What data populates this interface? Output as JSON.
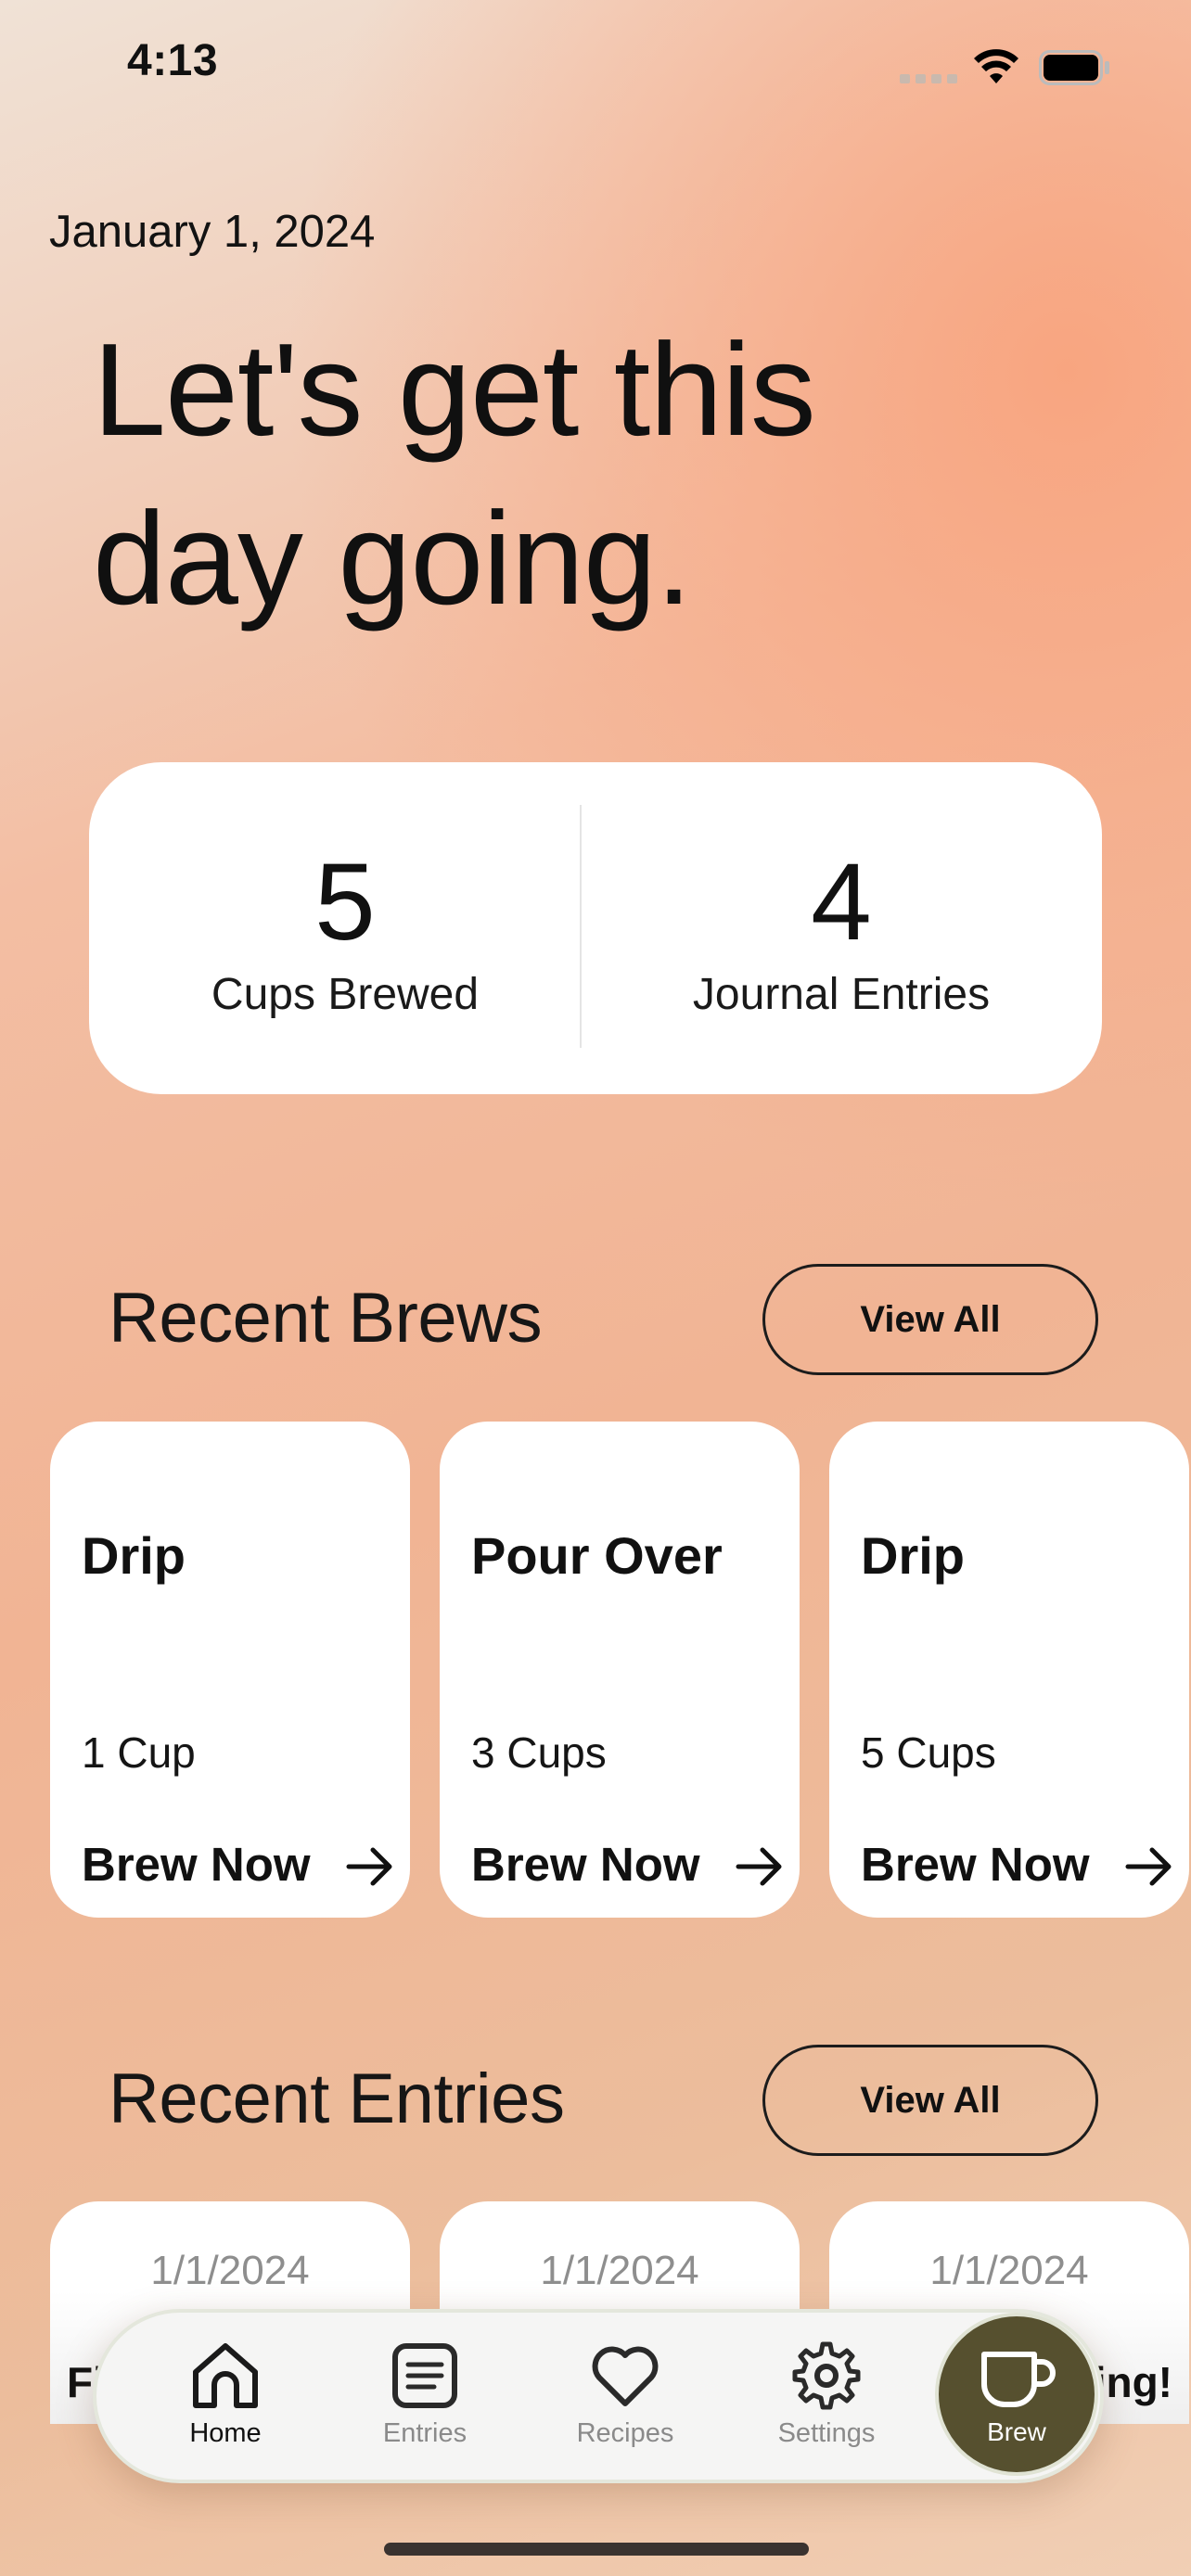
{
  "status_bar": {
    "time": "4:13"
  },
  "header": {
    "date": "January 1, 2024",
    "headline_line1": "Let's get this",
    "headline_line2": "day going."
  },
  "stats": [
    {
      "value": "5",
      "label": "Cups Brewed"
    },
    {
      "value": "4",
      "label": "Journal Entries"
    }
  ],
  "recent_brews": {
    "title": "Recent Brews",
    "view_all_label": "View All",
    "items": [
      {
        "type": "Drip",
        "cups": "1 Cup",
        "action": "Brew Now"
      },
      {
        "type": "Pour Over",
        "cups": "3 Cups",
        "action": "Brew Now"
      },
      {
        "type": "Drip",
        "cups": "5 Cups",
        "action": "Brew Now"
      }
    ]
  },
  "recent_entries": {
    "title": "Recent Entries",
    "view_all_label": "View All",
    "items": [
      {
        "date": "1/1/2024",
        "title_visible": "Fi"
      },
      {
        "date": "1/1/2024",
        "title_visible": ""
      },
      {
        "date": "1/1/2024",
        "title_visible": "ing!"
      }
    ]
  },
  "tab_bar": {
    "tabs": [
      {
        "label": "Home",
        "icon": "home-icon",
        "active": true
      },
      {
        "label": "Entries",
        "icon": "entries-icon",
        "active": false
      },
      {
        "label": "Recipes",
        "icon": "heart-icon",
        "active": false
      },
      {
        "label": "Settings",
        "icon": "gear-icon",
        "active": false
      }
    ],
    "fab": {
      "label": "Brew",
      "icon": "coffee-cup-icon"
    }
  },
  "colors": {
    "accent_dark_olive": "#56502f",
    "card_white": "#ffffff",
    "background_peach": "#f3b493"
  }
}
